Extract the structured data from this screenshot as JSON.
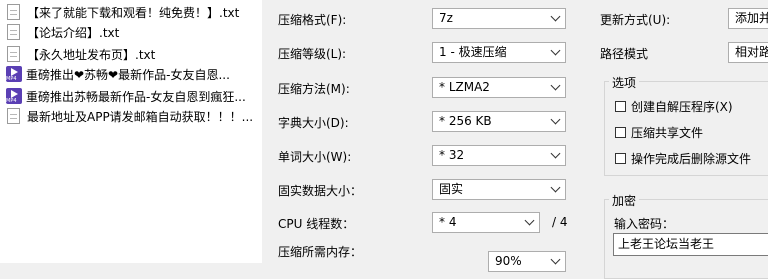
{
  "files": [
    {
      "icon": "txt-file-icon",
      "name": "【来了就能下载和观看！纯免费！】.txt"
    },
    {
      "icon": "txt-file-icon",
      "name": "【论坛介绍】.txt"
    },
    {
      "icon": "txt-file-icon",
      "name": "【永久地址发布页】.txt"
    },
    {
      "icon": "mp4-file-icon",
      "name": "重磅推出❤苏畅❤最新作品-女友自恩..."
    },
    {
      "icon": "mp4-file-icon",
      "name": "重磅推出苏畅最新作品-女友自恩到瘋狂..."
    },
    {
      "icon": "txt-file-icon",
      "name": "最新地址及APP请发邮箱自动获取！！！..."
    }
  ],
  "mp4_tag": "MP4",
  "settings": {
    "format": {
      "label": "压缩格式(F):",
      "value": "7z"
    },
    "level": {
      "label": "压缩等级(L):",
      "value": "1 - 极速压缩"
    },
    "method": {
      "label": "压缩方法(M):",
      "value": "* LZMA2"
    },
    "dict": {
      "label": "字典大小(D):",
      "value": "* 256 KB"
    },
    "word": {
      "label": "单词大小(W):",
      "value": "* 32"
    },
    "solid": {
      "label": "固实数据大小：",
      "value": "固实"
    },
    "cpu": {
      "label": "CPU 线程数：",
      "value": "* 4",
      "total": "/ 4"
    },
    "memory": {
      "label": "压缩所需内存：",
      "value": "90%"
    }
  },
  "right": {
    "update": {
      "label": "更新方式(U):",
      "value": "添加并"
    },
    "path": {
      "label": "路径模式",
      "value": "相对路"
    },
    "options_title": "选项",
    "options": [
      "创建自解压程序(X)",
      "压缩共享文件",
      "操作完成后删除源文件"
    ],
    "encrypt_title": "加密",
    "password_label": "输入密码：",
    "password_value": "上老王论坛当老王"
  }
}
